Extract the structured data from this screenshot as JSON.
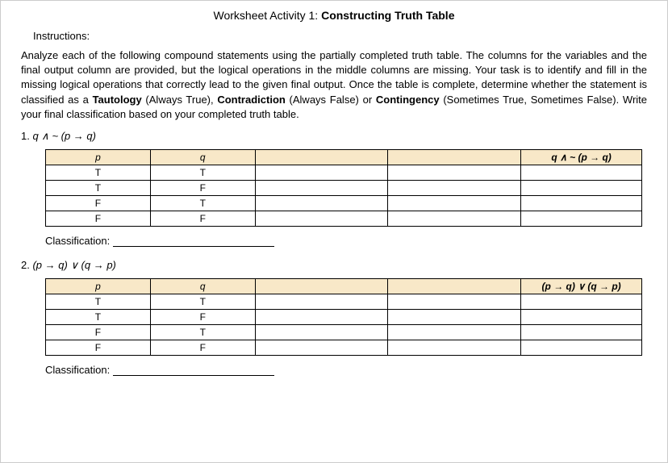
{
  "title_prefix": "Worksheet Activity 1: ",
  "title_bold": "Constructing Truth Table",
  "instructions_label": "Instructions:",
  "instructions_text_1": "Analyze each of the following compound statements using the partially completed truth table. The columns for the variables and the final output column are provided, but the logical operations in the middle columns are missing. Your task is to identify and fill in the missing logical operations that correctly lead to the given final output. Once the table is complete, determine whether the statement is classified as a ",
  "instructions_bold_1": "Tautology",
  "instructions_mid_1": " (Always True), ",
  "instructions_bold_2": "Contradiction",
  "instructions_mid_2": " (Always False) or ",
  "instructions_bold_3": "Contingency",
  "instructions_mid_3": " (Sometimes True, Sometimes False). Write your final classification based on your completed truth table.",
  "problem1": {
    "number": "1.  ",
    "expr": "q ∧ ~ (p → q)",
    "headers": {
      "p": "p",
      "q": "q",
      "mid1": "",
      "mid2": "",
      "last": "q ∧ ~ (p → q)"
    },
    "rows": [
      {
        "p": "T",
        "q": "T",
        "m1": "",
        "m2": "",
        "last": ""
      },
      {
        "p": "T",
        "q": "F",
        "m1": "",
        "m2": "",
        "last": ""
      },
      {
        "p": "F",
        "q": "T",
        "m1": "",
        "m2": "",
        "last": ""
      },
      {
        "p": "F",
        "q": "F",
        "m1": "",
        "m2": "",
        "last": ""
      }
    ],
    "classification_label": "Classification:"
  },
  "problem2": {
    "number": "2.  ",
    "expr": "(p → q) ∨ (q → p)",
    "headers": {
      "p": "p",
      "q": "q",
      "mid1": "",
      "mid2": "",
      "last": "(p → q) ∨ (q → p)"
    },
    "rows": [
      {
        "p": "T",
        "q": "T",
        "m1": "",
        "m2": "",
        "last": ""
      },
      {
        "p": "T",
        "q": "F",
        "m1": "",
        "m2": "",
        "last": ""
      },
      {
        "p": "F",
        "q": "T",
        "m1": "",
        "m2": "",
        "last": ""
      },
      {
        "p": "F",
        "q": "F",
        "m1": "",
        "m2": "",
        "last": ""
      }
    ],
    "classification_label": "Classification:"
  }
}
